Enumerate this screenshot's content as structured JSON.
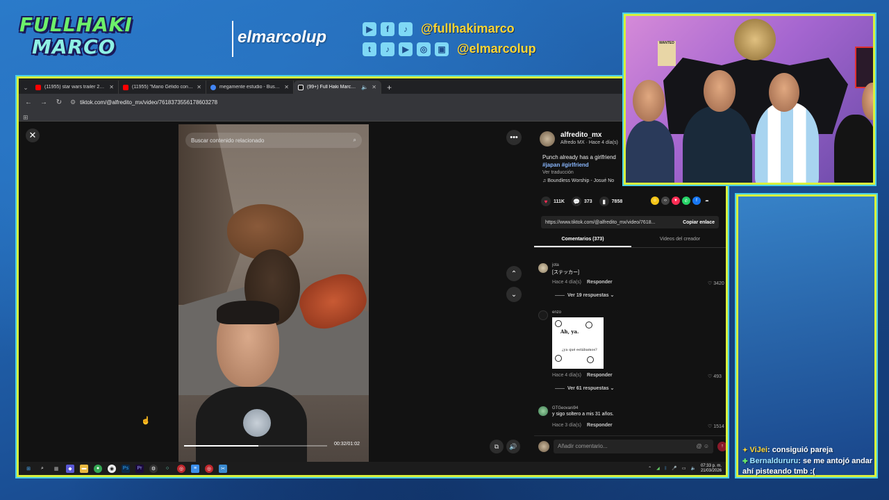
{
  "overlay": {
    "logo_line1": "FULLHAKI",
    "logo_line2": "MARCO",
    "channel_name": "elmarcolup",
    "social_handle_1": "@fullhakimarco",
    "social_handle_2": "@elmarcolup",
    "row1_icons": [
      "facebook-icon",
      "tiktok-icon"
    ],
    "row2_icons": [
      "twitter-icon",
      "tiktok-icon",
      "youtube-icon",
      "instagram-icon",
      "twitch-icon"
    ]
  },
  "browser": {
    "tabs": [
      {
        "label": "(11955) star wars trailer 2026 -",
        "favicon": "youtube",
        "color": "#ff0000",
        "active": false
      },
      {
        "label": "(11955) \"Mario Gélido convierte",
        "favicon": "youtube",
        "color": "#ff0000",
        "active": false
      },
      {
        "label": "megamente estudio - Buscar co",
        "favicon": "google",
        "color": "#4285f4",
        "active": false
      },
      {
        "label": "(99+) Full Haki Marco (@ful",
        "favicon": "tiktok",
        "color": "#ffffff",
        "active": true
      }
    ],
    "url": "tiktok.com/@alfredito_mx/video/7618373556178603278"
  },
  "video": {
    "search_placeholder": "Buscar contenido relacionado",
    "time": "00:32/01:02",
    "progress": 0.52
  },
  "panel": {
    "author_handle": "alfredito_mx",
    "author_meta": "Alfredo MX · Hace 4 día(s)",
    "description": "Punch already has a girlfriend",
    "tags": "#japan #girlfriend",
    "translate": "Ver traducción",
    "music": "Boundless Worship - Josué No",
    "likes": "111K",
    "comments_count": "373",
    "saves": "7858",
    "link": "https://www.tiktok.com/@alfredito_mx/video/7618...",
    "copy_link": "Copiar enlace",
    "tab_comments": "Comentarios (373)",
    "tab_creator": "Videos del creador",
    "comments": [
      {
        "user": "jota",
        "text": "[ステッカー]",
        "time": "Hace 4 día(s)",
        "reply": "Responder",
        "likes": "3420",
        "replies": "Ver 19 respuestas"
      },
      {
        "user": "enzo",
        "text": "",
        "time": "Hace 4 día(s)",
        "reply": "Responder",
        "likes": "493",
        "replies": "Ver 61 respuestas",
        "meme_top": "Ah, ya.",
        "meme_bottom": "¿ya qué estábamos?"
      },
      {
        "user": "GTGeovani94",
        "text": "y sigo soltero a mis 31 años.",
        "time": "Hace 3 día(s)",
        "reply": "Responder",
        "likes": "1514"
      }
    ],
    "comment_placeholder": "Añadir comentario..."
  },
  "taskbar": {
    "time": "07:33 p. m.",
    "date": "21/03/2026"
  },
  "webcam": {
    "poster_text": "WANTED"
  },
  "chat": [
    {
      "user": "ViJei",
      "message": ": consiguió pareja"
    },
    {
      "user": "Bernaldururu",
      "message": ": se me antojó andar ahí pisteando tmb :("
    }
  ]
}
